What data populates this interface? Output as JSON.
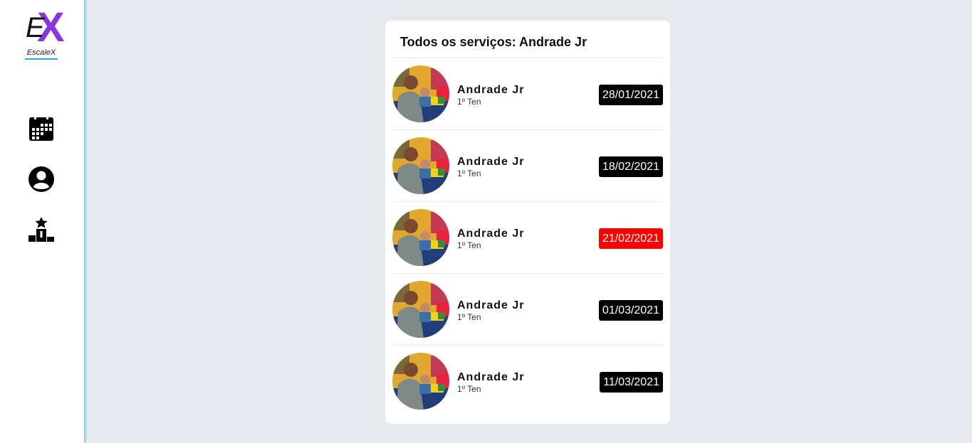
{
  "app": {
    "logo_letters": "EX",
    "logo_text": "EscaleX",
    "colors": {
      "accent": "#8a35e0",
      "underline": "#2ba7d8",
      "highlight_date": "#ff0000",
      "default_date": "#000000",
      "background": "#e6eaef"
    }
  },
  "sidebar": {
    "items": [
      {
        "icon": "calendar-icon"
      },
      {
        "icon": "account-circle-icon"
      },
      {
        "icon": "podium-star-icon"
      }
    ]
  },
  "main": {
    "title": "Todos os serviços: Andrade Jr",
    "services": [
      {
        "name": "Andrade Jr",
        "rank": "1º Ten",
        "date": "28/01/2021",
        "highlight": false
      },
      {
        "name": "Andrade Jr",
        "rank": "1º Ten",
        "date": "18/02/2021",
        "highlight": false
      },
      {
        "name": "Andrade Jr",
        "rank": "1º Ten",
        "date": "21/02/2021",
        "highlight": true
      },
      {
        "name": "Andrade Jr",
        "rank": "1º Ten",
        "date": "01/03/2021",
        "highlight": false
      },
      {
        "name": "Andrade Jr",
        "rank": "1º Ten",
        "date": "11/03/2021",
        "highlight": false
      }
    ]
  }
}
